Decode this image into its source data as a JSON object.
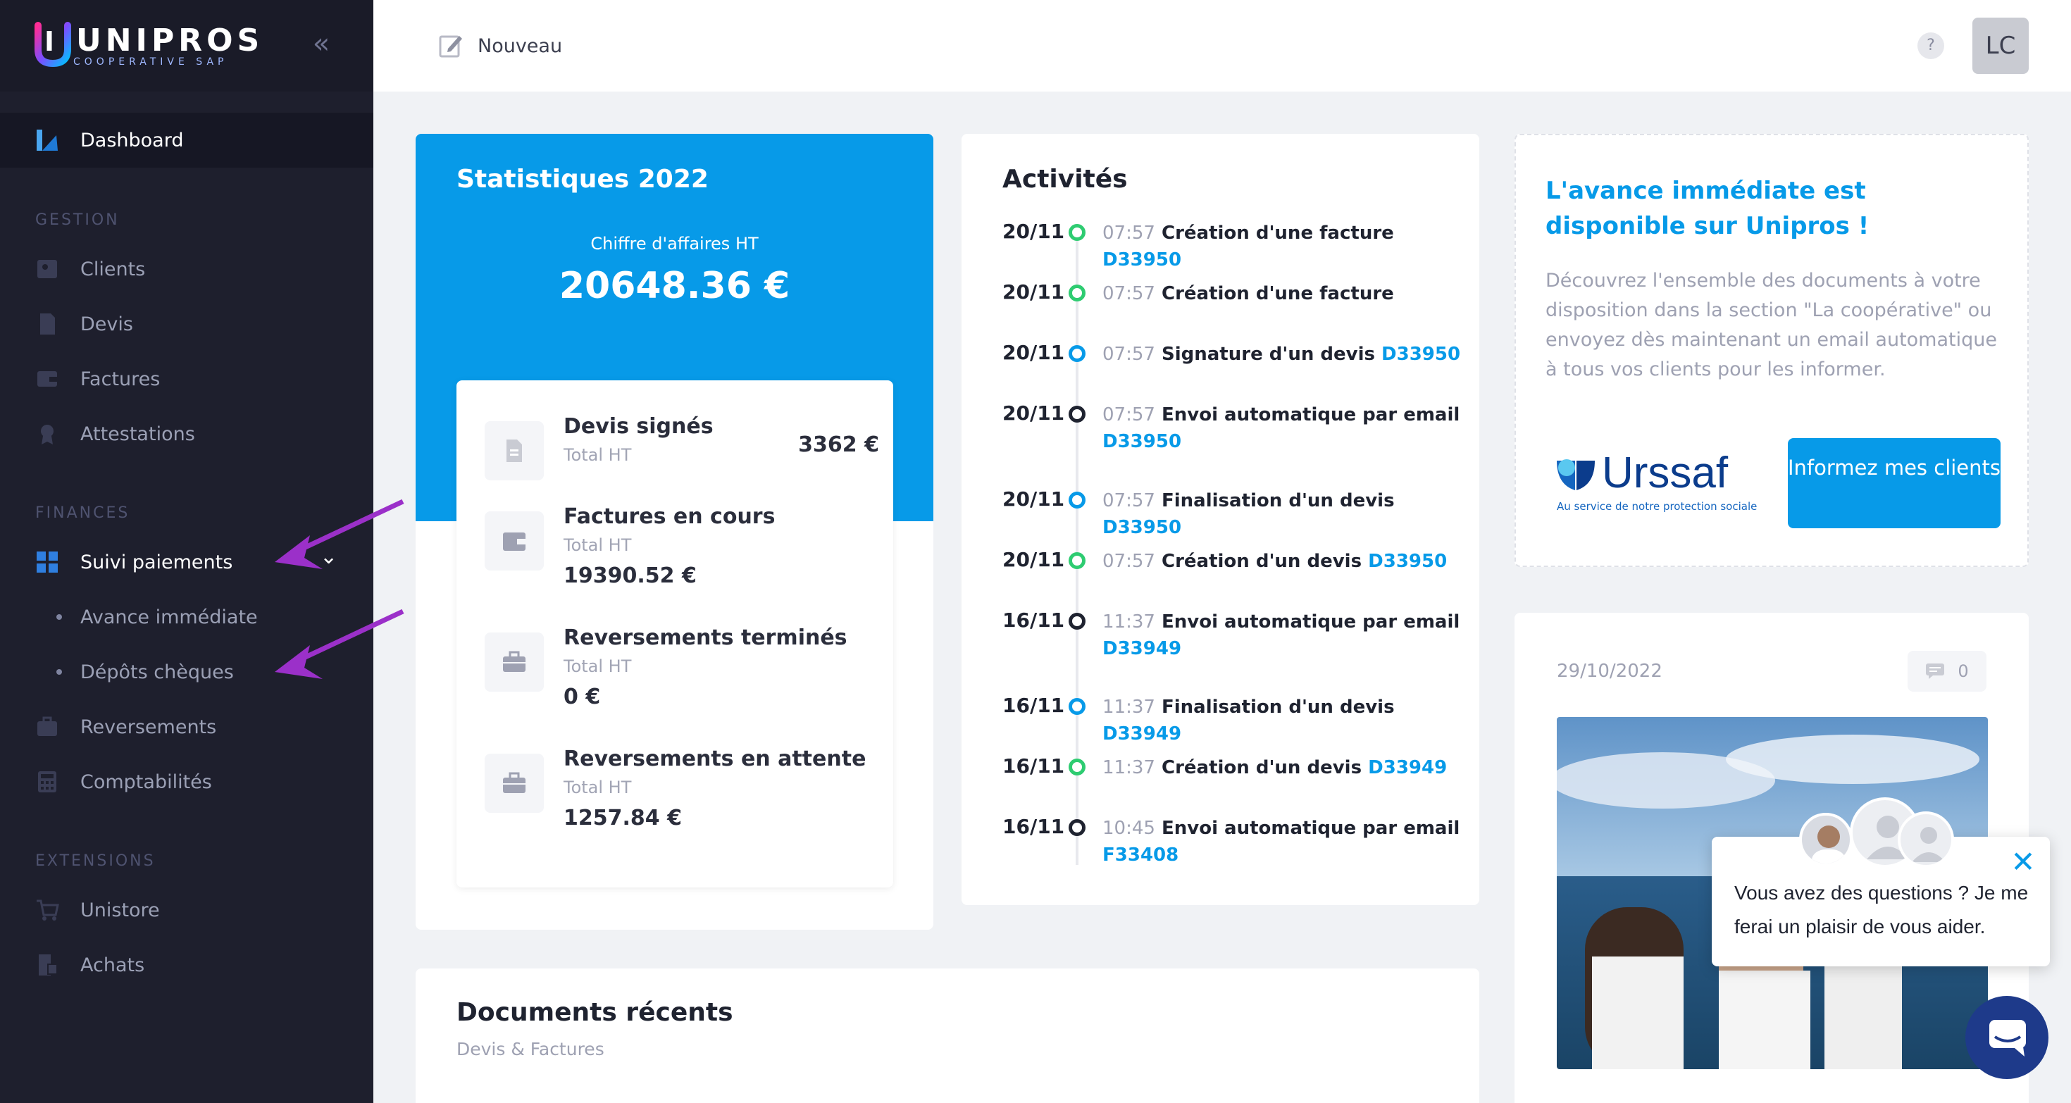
{
  "brand": {
    "name_a": "UNI",
    "name_b": "PROS",
    "tagline": "COOPERATIVE SAP"
  },
  "sidebar": {
    "collapse_glyph": "«",
    "dashboard": "Dashboard",
    "sections": {
      "gestion": "GESTION",
      "finances": "FINANCES",
      "extensions": "EXTENSIONS"
    },
    "items": {
      "clients": "Clients",
      "devis": "Devis",
      "factures": "Factures",
      "attestations": "Attestations",
      "suivi": "Suivi paiements",
      "avance": "Avance immédiate",
      "depots": "Dépôts chèques",
      "reversements": "Reversements",
      "comptabilites": "Comptabilités",
      "unistore": "Unistore",
      "achats": "Achats"
    },
    "chevron": "⌄"
  },
  "header": {
    "new_label": "Nouveau",
    "help": "?",
    "avatar": "LC"
  },
  "stats": {
    "title": "Statistiques 2022",
    "ca_label": "Chiffre d'affaires HT",
    "ca_value": "20648.36 €",
    "rows": [
      {
        "title": "Devis signés",
        "sub": "Total HT",
        "value": "3362 €"
      },
      {
        "title": "Factures en cours",
        "sub": "Total HT",
        "value": "19390.52 €"
      },
      {
        "title": "Reversements terminés",
        "sub": "Total HT",
        "value": "0 €"
      },
      {
        "title": "Reversements en attente",
        "sub": "Total HT",
        "value": "1257.84 €"
      }
    ]
  },
  "activities": {
    "title": "Activités",
    "items": [
      {
        "date": "20/11",
        "time": "07:57",
        "text": "Création d'une facture",
        "ref": "D33950",
        "color": "#2ecc71"
      },
      {
        "date": "20/11",
        "time": "07:57",
        "text": "Création d'une facture",
        "ref": "",
        "color": "#2ecc71"
      },
      {
        "date": "20/11",
        "time": "07:57",
        "text": "Signature d'un devis",
        "ref": "D33950",
        "color": "#079ae8"
      },
      {
        "date": "20/11",
        "time": "07:57",
        "text": "Envoi automatique par email",
        "ref": "D33950",
        "color": "#1f2330"
      },
      {
        "date": "20/11",
        "time": "07:57",
        "text": "Finalisation d'un devis",
        "ref": "D33950",
        "color": "#079ae8"
      },
      {
        "date": "20/11",
        "time": "07:57",
        "text": "Création d'un devis",
        "ref": "D33950",
        "color": "#2ecc71"
      },
      {
        "date": "16/11",
        "time": "11:37",
        "text": "Envoi automatique par email",
        "ref": "D33949",
        "color": "#1f2330"
      },
      {
        "date": "16/11",
        "time": "11:37",
        "text": "Finalisation d'un devis",
        "ref": "D33949",
        "color": "#079ae8"
      },
      {
        "date": "16/11",
        "time": "11:37",
        "text": "Création d'un devis",
        "ref": "D33949",
        "color": "#2ecc71"
      },
      {
        "date": "16/11",
        "time": "10:45",
        "text": "Envoi automatique par email",
        "ref": "F33408",
        "color": "#1f2330"
      }
    ]
  },
  "urssaf": {
    "title": "L'avance immédiate est disponible sur Unipros !",
    "desc": "Découvrez l'ensemble des documents à votre disposition dans la section \"La coopérative\" ou envoyez dès maintenant un email automatique à tous vos clients pour les informer.",
    "logo_name": "Urssaf",
    "logo_tagline": "Au service de notre protection sociale",
    "button": "Informez mes clients"
  },
  "post": {
    "date": "29/10/2022",
    "comments": "0"
  },
  "docs": {
    "title": "Documents récents",
    "sub": "Devis & Factures"
  },
  "chat": {
    "message": "Vous avez des questions ? Je me ferai un plaisir de vous aider.",
    "close": "✕"
  },
  "colors": {
    "accent": "#079ae8",
    "sidebar": "#1e1f2d",
    "arrow": "#9b30c9"
  }
}
